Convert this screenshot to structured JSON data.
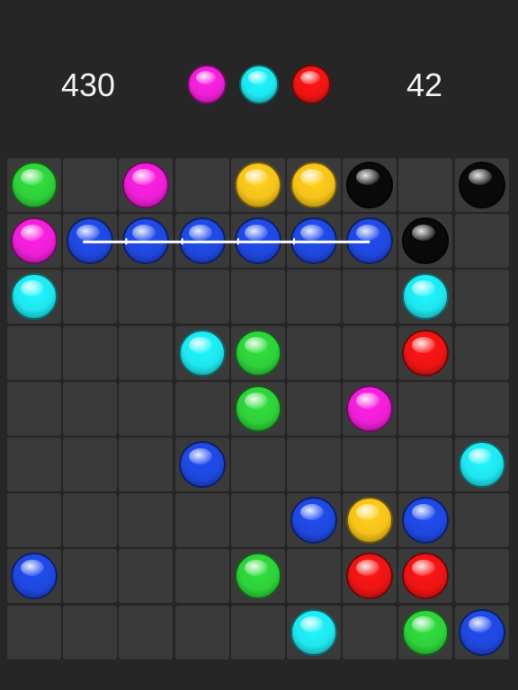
{
  "hud": {
    "score": "430",
    "moves": "42",
    "next_balls": [
      "magenta",
      "cyan",
      "red"
    ]
  },
  "colors": {
    "green": "#2ed13a",
    "magenta": "#ee1fd6",
    "yellow": "#f5c21a",
    "black": "#0a0a0a",
    "blue": "#1f48e0",
    "cyan": "#1ee6ee",
    "red": "#ee1414",
    "board_bg": "#262626",
    "cell_bg": "#3a3a3a",
    "path_line": "#ffffff"
  },
  "board": {
    "rows": 9,
    "cols": 9,
    "grid": [
      [
        "green",
        "",
        "magenta",
        "",
        "yellow",
        "yellow",
        "black",
        "",
        "black"
      ],
      [
        "magenta",
        "blue",
        "blue",
        "blue",
        "blue",
        "blue",
        "blue",
        "black",
        ""
      ],
      [
        "cyan",
        "",
        "",
        "",
        "",
        "",
        "",
        "cyan",
        ""
      ],
      [
        "",
        "",
        "",
        "cyan",
        "green",
        "",
        "",
        "red",
        ""
      ],
      [
        "",
        "",
        "",
        "",
        "green",
        "",
        "magenta",
        "",
        ""
      ],
      [
        "",
        "",
        "",
        "blue",
        "",
        "",
        "",
        "",
        "cyan"
      ],
      [
        "",
        "",
        "",
        "",
        "",
        "blue",
        "yellow",
        "blue",
        ""
      ],
      [
        "blue",
        "",
        "",
        "",
        "green",
        "",
        "red",
        "red",
        ""
      ],
      [
        "",
        "",
        "",
        "",
        "",
        "cyan",
        "",
        "green",
        "blue"
      ]
    ],
    "path": {
      "row": 1,
      "from_col": 1,
      "to_col": 6
    }
  }
}
